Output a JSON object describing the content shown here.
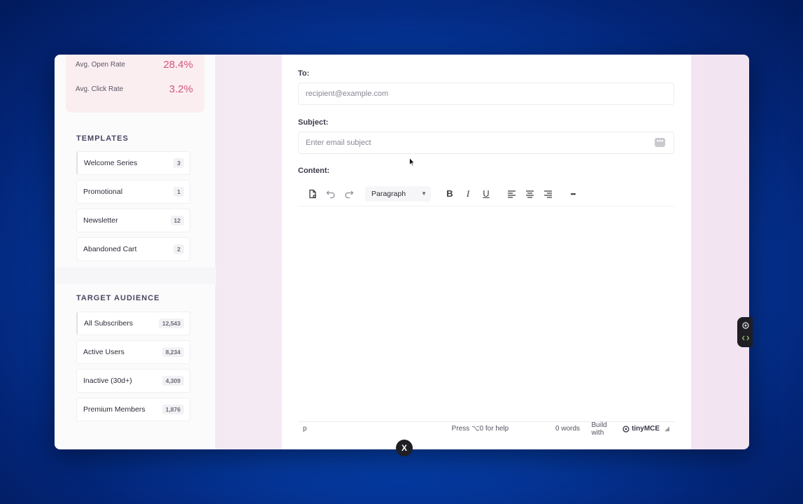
{
  "stats": {
    "open_rate_label": "Avg. Open Rate",
    "open_rate_value": "28.4%",
    "click_rate_label": "Avg. Click Rate",
    "click_rate_value": "3.2%"
  },
  "templates": {
    "title": "TEMPLATES",
    "items": [
      {
        "label": "Welcome Series",
        "count": "3"
      },
      {
        "label": "Promotional",
        "count": "1"
      },
      {
        "label": "Newsletter",
        "count": "12"
      },
      {
        "label": "Abandoned Cart",
        "count": "2"
      }
    ]
  },
  "audience": {
    "title": "TARGET AUDIENCE",
    "items": [
      {
        "label": "All Subscribers",
        "count": "12,543"
      },
      {
        "label": "Active Users",
        "count": "8,234"
      },
      {
        "label": "Inactive (30d+)",
        "count": "4,309"
      },
      {
        "label": "Premium Members",
        "count": "1,876"
      }
    ]
  },
  "compose": {
    "to_label": "To:",
    "to_placeholder": "recipient@example.com",
    "subject_label": "Subject:",
    "subject_placeholder": "Enter email subject",
    "content_label": "Content:"
  },
  "editor": {
    "block_format": "Paragraph",
    "bold": "B",
    "italic": "I",
    "underline": "U",
    "more": "•••",
    "status_path": "p",
    "status_help": "Press ⌥0 for help",
    "status_words": "0 words",
    "build_with": "Build with",
    "brand": "tinyMCE"
  },
  "close_badge": "X",
  "colors": {
    "accent": "#d5557a",
    "background": "#0646b8"
  }
}
